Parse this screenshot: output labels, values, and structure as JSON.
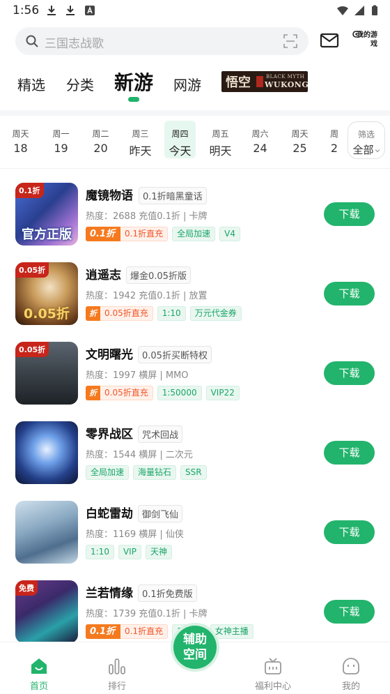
{
  "status_bar": {
    "time": "1:56"
  },
  "search": {
    "placeholder": "三国志战歌"
  },
  "header": {
    "my_games_label": "我的游戏"
  },
  "tabs": [
    {
      "label": "精选"
    },
    {
      "label": "分类"
    },
    {
      "label": "新游",
      "active": true
    },
    {
      "label": "网游"
    }
  ],
  "banner": {
    "han": "悟空",
    "line1": "BLACK MYTH",
    "line2": "WUKONG"
  },
  "days": [
    {
      "weekday": "周天",
      "date": "18"
    },
    {
      "weekday": "周一",
      "date": "19"
    },
    {
      "weekday": "周二",
      "date": "20"
    },
    {
      "weekday": "周三",
      "date": "昨天"
    },
    {
      "weekday": "周四",
      "date": "今天",
      "active": true
    },
    {
      "weekday": "周五",
      "date": "明天"
    },
    {
      "weekday": "周六",
      "date": "24"
    },
    {
      "weekday": "周天",
      "date": "25"
    },
    {
      "weekday": "周",
      "date": "2"
    }
  ],
  "filter": {
    "label": "筛选",
    "value": "全部"
  },
  "games": [
    {
      "name": "魔镜物语",
      "subtitle": "0.1折暗黑童话",
      "meta": "热度：2688   充值0.1折 | 卡牌",
      "cover_tag": "0.1折",
      "cover_banner": "官方正版",
      "discount": {
        "badge": "0.1折",
        "text": "0.1折直充"
      },
      "tags": [
        "全局加速",
        "V4"
      ],
      "button": "下载"
    },
    {
      "name": "逍遥志",
      "subtitle": "爆金0.05折版",
      "meta": "热度：1942   充值0.1折 | 放置",
      "cover_tag": "0.05折",
      "cover_banner": "0.05折",
      "discount": {
        "badge": "折",
        "text": "0.05折直充"
      },
      "tags": [
        "1:10",
        "万元代金券"
      ],
      "button": "下载"
    },
    {
      "name": "文明曙光",
      "subtitle": "0.05折买断特权",
      "meta": "热度：1997   横屏 | MMO",
      "cover_tag": "0.05折",
      "cover_banner": "",
      "discount": {
        "badge": "折",
        "text": "0.05折直充"
      },
      "tags": [
        "1:50000",
        "VIP22"
      ],
      "button": "下载"
    },
    {
      "name": "零界战区",
      "subtitle": "咒术回战",
      "meta": "热度：1544   横屏 | 二次元",
      "cover_tag": "",
      "cover_banner": "",
      "discount": null,
      "tags": [
        "全局加速",
        "海量钻石",
        "SSR"
      ],
      "button": "下载"
    },
    {
      "name": "白蛇雷劫",
      "subtitle": "御剑飞仙",
      "meta": "热度：1169   横屏 | 仙侠",
      "cover_tag": "",
      "cover_banner": "",
      "discount": null,
      "tags": [
        "1:10",
        "VIP",
        "天神"
      ],
      "button": "下载"
    },
    {
      "name": "兰若情缘",
      "subtitle": "0.1折免费版",
      "meta": "热度：1739   充值0.1折 | 卡牌",
      "cover_tag": "免费",
      "cover_banner": "",
      "discount": {
        "badge": "0.1折",
        "text": "0.1折直充"
      },
      "tags": [
        "1:120",
        "女神主播"
      ],
      "button": "下载"
    }
  ],
  "center_button": {
    "line1": "辅助",
    "line2": "空间"
  },
  "bottom_nav": [
    {
      "label": "首页",
      "active": true
    },
    {
      "label": "排行"
    },
    {
      "label": "福利中心"
    },
    {
      "label": "我的"
    }
  ],
  "colors": {
    "accent": "#22b46c",
    "discount_orange": "#f57a1f",
    "tag_green": "#1aa567"
  }
}
